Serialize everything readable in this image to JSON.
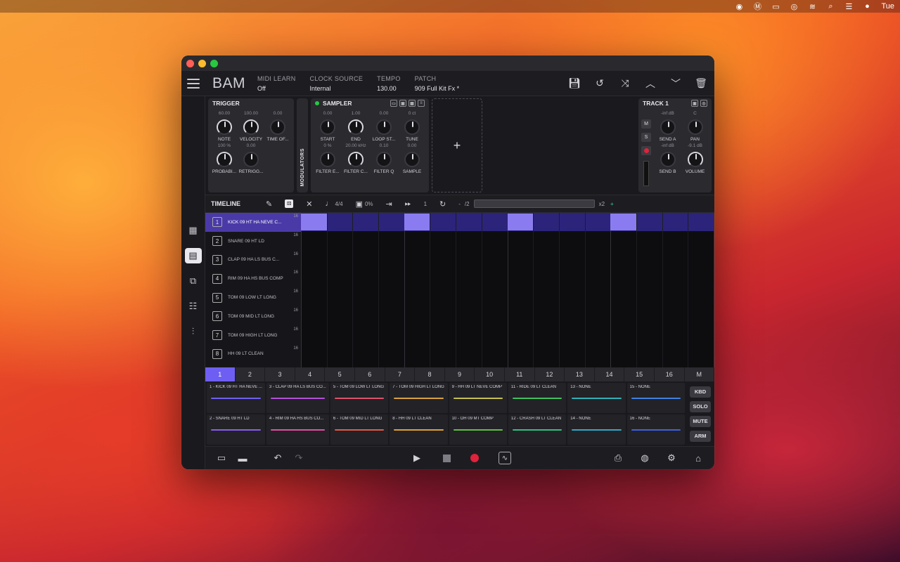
{
  "menubar": {
    "clock": "Tue"
  },
  "app": {
    "logo": "BAM",
    "controls": [
      {
        "key": "MIDI LEARN",
        "value": "Off"
      },
      {
        "key": "CLOCK SOURCE",
        "value": "Internal"
      },
      {
        "key": "TEMPO",
        "value": "130.00"
      },
      {
        "key": "PATCH",
        "value": "909 Full Kit Fx *"
      }
    ]
  },
  "trigger": {
    "title": "TRIGGER",
    "knobs": [
      {
        "value": "60.00",
        "label": "NOTE"
      },
      {
        "value": "100.00",
        "label": "VELOCITY"
      },
      {
        "value": "0.00",
        "label": "TIME OF..."
      },
      {
        "value": "100 %",
        "label": "PROBABI..."
      },
      {
        "value": "0.00",
        "label": "RETRIGG..."
      }
    ]
  },
  "modulators": {
    "label": "MODULATORS"
  },
  "sampler": {
    "title": "SAMPLER",
    "knobs": [
      {
        "value": "0.00",
        "label": "START"
      },
      {
        "value": "1.00",
        "label": "END"
      },
      {
        "value": "0.00",
        "label": "LOOP ST..."
      },
      {
        "value": "0 ct",
        "label": "TUNE"
      },
      {
        "value": "0 %",
        "label": "FILTER E..."
      },
      {
        "value": "20.00 kHz",
        "label": "FILTER C..."
      },
      {
        "value": "0.10",
        "label": "FILTER Q"
      },
      {
        "value": "0.00",
        "label": "SAMPLE"
      }
    ],
    "add_symbol": "+"
  },
  "track": {
    "title": "TRACK 1",
    "mute": "M",
    "solo": "S",
    "knobs": [
      {
        "value": "-inf dB",
        "label": "SEND A"
      },
      {
        "value": "C",
        "label": "PAN"
      },
      {
        "value": "-inf dB",
        "label": "SEND B"
      },
      {
        "value": "-9.1 dB",
        "label": "VOLUME"
      }
    ]
  },
  "timeline": {
    "title": "TIMELINE",
    "time_sig": "4/4",
    "swing": "0%",
    "step": "1",
    "minus": "-",
    "div": "/2",
    "mult": "x2",
    "plus": "+"
  },
  "tracks": [
    {
      "num": "1",
      "name": "KICK 09 HT HA NEVE C...",
      "len": "16"
    },
    {
      "num": "2",
      "name": "SNARE 09 HT LD",
      "len": "16"
    },
    {
      "num": "3",
      "name": "CLAP 09 HA LS BUS C...",
      "len": "16"
    },
    {
      "num": "4",
      "name": "RIM 09 HA HS BUS COMP",
      "len": "16"
    },
    {
      "num": "5",
      "name": "TOM 09 LOW LT LONG",
      "len": "16"
    },
    {
      "num": "6",
      "name": "TOM 09 MID LT LONG",
      "len": "16"
    },
    {
      "num": "7",
      "name": "TOM 09 HIGH LT LONG",
      "len": "16"
    },
    {
      "num": "8",
      "name": "HH 09 LT CLEAN",
      "len": "16"
    }
  ],
  "patterns": [
    "1",
    "2",
    "3",
    "4",
    "5",
    "6",
    "7",
    "8",
    "9",
    "10",
    "11",
    "12",
    "13",
    "14",
    "15",
    "16",
    "M"
  ],
  "pads": [
    {
      "name": "1 - KICK 09 HT HA NEVE ...",
      "color": "#6f5ff0"
    },
    {
      "name": "3 - CLAP 09 HA LS BUS CO...",
      "color": "#b44fd8"
    },
    {
      "name": "5 - TOM 09 LOW LT LONG",
      "color": "#e0506a"
    },
    {
      "name": "7 - TOM 09 HIGH LT LONG",
      "color": "#d8a040"
    },
    {
      "name": "9 - HH 09 LT NEVE COMP",
      "color": "#c8c050"
    },
    {
      "name": "11 - RIDE 09 LT CLEAN",
      "color": "#40c060"
    },
    {
      "name": "13 - NONE",
      "color": "#30b0b8"
    },
    {
      "name": "15 - NONE",
      "color": "#4080e0"
    },
    {
      "name": "2 - SNARE 09 HT LD",
      "color": "#8a5cf0"
    },
    {
      "name": "4 - RIM 09 HA HS BUS CO...",
      "color": "#e050a0"
    },
    {
      "name": "6 - TOM 09 MID LT LONG",
      "color": "#e05a4a"
    },
    {
      "name": "8 - HH 09 LT CLEAN",
      "color": "#e0a030"
    },
    {
      "name": "10 - OH 09 MT COMP",
      "color": "#60c040"
    },
    {
      "name": "12 - CRASH 09 LT CLEAN",
      "color": "#30c080"
    },
    {
      "name": "14 - NONE",
      "color": "#30a8c8"
    },
    {
      "name": "16 - NONE",
      "color": "#4060e0"
    }
  ],
  "modes": [
    "KBD",
    "SOLO",
    "MUTE",
    "ARM"
  ],
  "steps": {
    "active": [
      1,
      5,
      9,
      13
    ],
    "total": 16
  }
}
